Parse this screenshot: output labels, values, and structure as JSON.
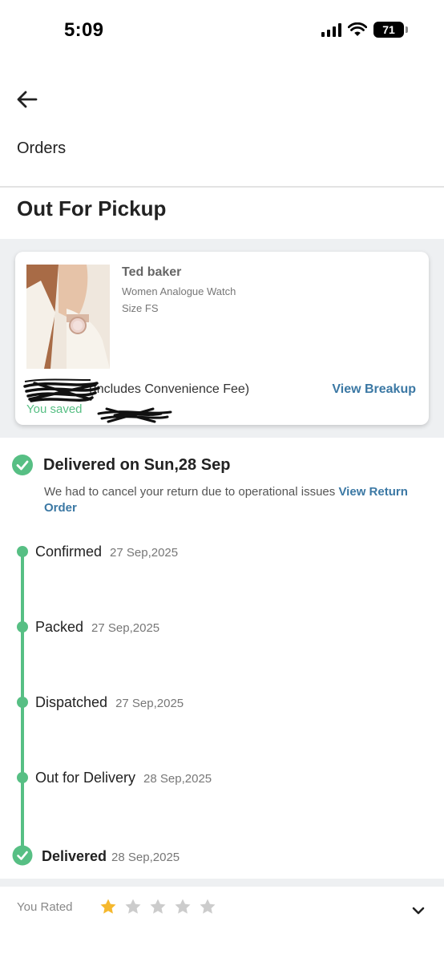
{
  "status_bar": {
    "time": "5:09",
    "battery": "71"
  },
  "nav": {
    "title": "Orders"
  },
  "order": {
    "status_heading": "Out For Pickup"
  },
  "product": {
    "brand": "Ted baker",
    "description": "Women Analogue Watch",
    "size": "Size FS",
    "price_note": "(Includes Convenience Fee)",
    "view_breakup": "View Breakup",
    "saved_text": "You saved"
  },
  "delivery": {
    "title": "Delivered on Sun,28 Sep",
    "cancel_note": "We had to cancel your return due to operational issues",
    "cancel_link": "View Return Order"
  },
  "timeline": [
    {
      "label": "Confirmed",
      "date": "27 Sep,2025"
    },
    {
      "label": "Packed",
      "date": "27 Sep,2025"
    },
    {
      "label": "Dispatched",
      "date": "27 Sep,2025"
    },
    {
      "label": "Out for Delivery",
      "date": "28 Sep,2025"
    },
    {
      "label": "Delivered",
      "date": "28 Sep,2025"
    }
  ],
  "rating": {
    "label": "You Rated",
    "value": 1,
    "max": 5
  },
  "colors": {
    "accent_green": "#57bf84",
    "link_blue": "#3b78a4",
    "star_gold": "#f5b82e",
    "star_gray": "#cccccc"
  },
  "icons": [
    "back-arrow-icon",
    "signal-icon",
    "wifi-icon",
    "battery-icon",
    "check-circle-icon",
    "star-icon",
    "chevron-down-icon"
  ]
}
